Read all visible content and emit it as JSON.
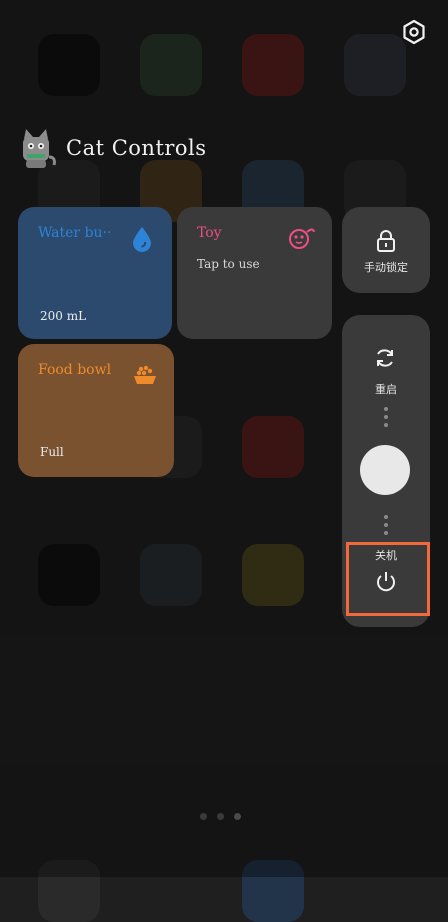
{
  "header": {
    "title": "Cat Controls"
  },
  "cards": {
    "water": {
      "title": "Water bu··",
      "value": "200 mL",
      "color": "#2d83d6"
    },
    "toy": {
      "title": "Toy",
      "subtitle": "Tap to use",
      "color": "#ec4f81"
    },
    "food": {
      "title": "Food bowl",
      "value": "Full",
      "color": "#ef8b2a"
    }
  },
  "side_panel": {
    "lock_label": "手动锁定",
    "restart_label": "重启",
    "power_off_label": "关机"
  },
  "colors": {
    "water_card_bg": "#2c4a6d",
    "food_card_bg": "#7a5230",
    "tile_bg": "#3a3a3a",
    "highlight": "#f2693b"
  }
}
